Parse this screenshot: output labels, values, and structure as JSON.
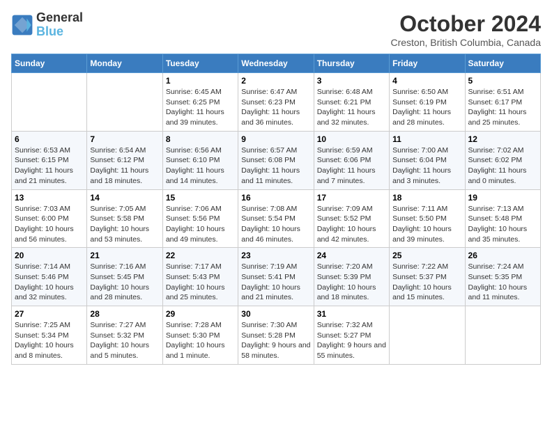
{
  "logo": {
    "line1": "General",
    "line2": "Blue"
  },
  "title": "October 2024",
  "location": "Creston, British Columbia, Canada",
  "weekdays": [
    "Sunday",
    "Monday",
    "Tuesday",
    "Wednesday",
    "Thursday",
    "Friday",
    "Saturday"
  ],
  "weeks": [
    [
      {
        "day": "",
        "info": ""
      },
      {
        "day": "",
        "info": ""
      },
      {
        "day": "1",
        "info": "Sunrise: 6:45 AM\nSunset: 6:25 PM\nDaylight: 11 hours and 39 minutes."
      },
      {
        "day": "2",
        "info": "Sunrise: 6:47 AM\nSunset: 6:23 PM\nDaylight: 11 hours and 36 minutes."
      },
      {
        "day": "3",
        "info": "Sunrise: 6:48 AM\nSunset: 6:21 PM\nDaylight: 11 hours and 32 minutes."
      },
      {
        "day": "4",
        "info": "Sunrise: 6:50 AM\nSunset: 6:19 PM\nDaylight: 11 hours and 28 minutes."
      },
      {
        "day": "5",
        "info": "Sunrise: 6:51 AM\nSunset: 6:17 PM\nDaylight: 11 hours and 25 minutes."
      }
    ],
    [
      {
        "day": "6",
        "info": "Sunrise: 6:53 AM\nSunset: 6:15 PM\nDaylight: 11 hours and 21 minutes."
      },
      {
        "day": "7",
        "info": "Sunrise: 6:54 AM\nSunset: 6:12 PM\nDaylight: 11 hours and 18 minutes."
      },
      {
        "day": "8",
        "info": "Sunrise: 6:56 AM\nSunset: 6:10 PM\nDaylight: 11 hours and 14 minutes."
      },
      {
        "day": "9",
        "info": "Sunrise: 6:57 AM\nSunset: 6:08 PM\nDaylight: 11 hours and 11 minutes."
      },
      {
        "day": "10",
        "info": "Sunrise: 6:59 AM\nSunset: 6:06 PM\nDaylight: 11 hours and 7 minutes."
      },
      {
        "day": "11",
        "info": "Sunrise: 7:00 AM\nSunset: 6:04 PM\nDaylight: 11 hours and 3 minutes."
      },
      {
        "day": "12",
        "info": "Sunrise: 7:02 AM\nSunset: 6:02 PM\nDaylight: 11 hours and 0 minutes."
      }
    ],
    [
      {
        "day": "13",
        "info": "Sunrise: 7:03 AM\nSunset: 6:00 PM\nDaylight: 10 hours and 56 minutes."
      },
      {
        "day": "14",
        "info": "Sunrise: 7:05 AM\nSunset: 5:58 PM\nDaylight: 10 hours and 53 minutes."
      },
      {
        "day": "15",
        "info": "Sunrise: 7:06 AM\nSunset: 5:56 PM\nDaylight: 10 hours and 49 minutes."
      },
      {
        "day": "16",
        "info": "Sunrise: 7:08 AM\nSunset: 5:54 PM\nDaylight: 10 hours and 46 minutes."
      },
      {
        "day": "17",
        "info": "Sunrise: 7:09 AM\nSunset: 5:52 PM\nDaylight: 10 hours and 42 minutes."
      },
      {
        "day": "18",
        "info": "Sunrise: 7:11 AM\nSunset: 5:50 PM\nDaylight: 10 hours and 39 minutes."
      },
      {
        "day": "19",
        "info": "Sunrise: 7:13 AM\nSunset: 5:48 PM\nDaylight: 10 hours and 35 minutes."
      }
    ],
    [
      {
        "day": "20",
        "info": "Sunrise: 7:14 AM\nSunset: 5:46 PM\nDaylight: 10 hours and 32 minutes."
      },
      {
        "day": "21",
        "info": "Sunrise: 7:16 AM\nSunset: 5:45 PM\nDaylight: 10 hours and 28 minutes."
      },
      {
        "day": "22",
        "info": "Sunrise: 7:17 AM\nSunset: 5:43 PM\nDaylight: 10 hours and 25 minutes."
      },
      {
        "day": "23",
        "info": "Sunrise: 7:19 AM\nSunset: 5:41 PM\nDaylight: 10 hours and 21 minutes."
      },
      {
        "day": "24",
        "info": "Sunrise: 7:20 AM\nSunset: 5:39 PM\nDaylight: 10 hours and 18 minutes."
      },
      {
        "day": "25",
        "info": "Sunrise: 7:22 AM\nSunset: 5:37 PM\nDaylight: 10 hours and 15 minutes."
      },
      {
        "day": "26",
        "info": "Sunrise: 7:24 AM\nSunset: 5:35 PM\nDaylight: 10 hours and 11 minutes."
      }
    ],
    [
      {
        "day": "27",
        "info": "Sunrise: 7:25 AM\nSunset: 5:34 PM\nDaylight: 10 hours and 8 minutes."
      },
      {
        "day": "28",
        "info": "Sunrise: 7:27 AM\nSunset: 5:32 PM\nDaylight: 10 hours and 5 minutes."
      },
      {
        "day": "29",
        "info": "Sunrise: 7:28 AM\nSunset: 5:30 PM\nDaylight: 10 hours and 1 minute."
      },
      {
        "day": "30",
        "info": "Sunrise: 7:30 AM\nSunset: 5:28 PM\nDaylight: 9 hours and 58 minutes."
      },
      {
        "day": "31",
        "info": "Sunrise: 7:32 AM\nSunset: 5:27 PM\nDaylight: 9 hours and 55 minutes."
      },
      {
        "day": "",
        "info": ""
      },
      {
        "day": "",
        "info": ""
      }
    ]
  ]
}
